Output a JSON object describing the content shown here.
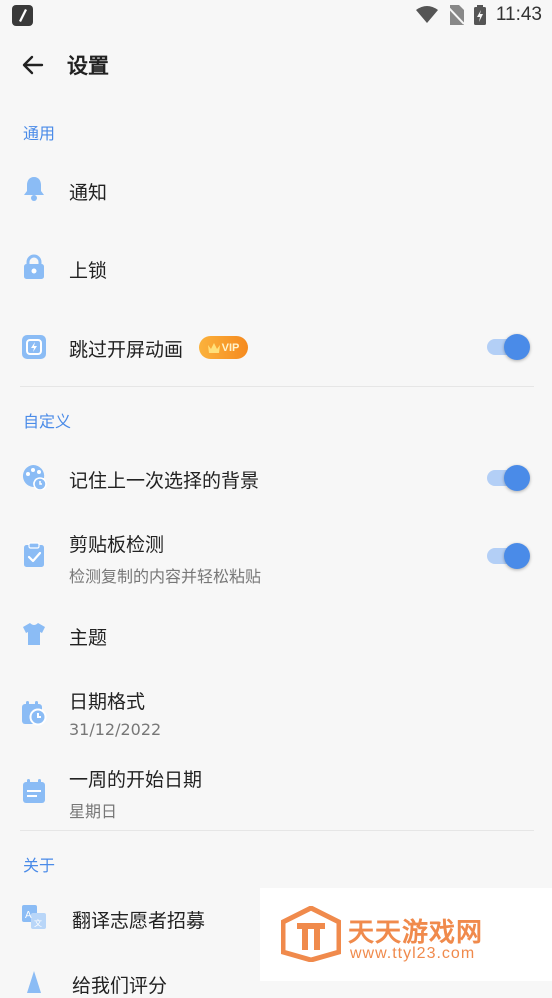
{
  "status_bar": {
    "time": "11:43"
  },
  "app_bar": {
    "title": "设置"
  },
  "sections": {
    "general": "通用",
    "custom": "自定义",
    "about": "关于"
  },
  "items": {
    "notification": {
      "label": "通知"
    },
    "lock": {
      "label": "上锁"
    },
    "skip_splash": {
      "label": "跳过开屏动画",
      "badge": "VIP",
      "toggle_on": true
    },
    "remember_bg": {
      "label": "记住上一次选择的背景",
      "toggle_on": true
    },
    "clipboard": {
      "label": "剪贴板检测",
      "subtitle": "检测复制的内容并轻松粘贴",
      "toggle_on": true
    },
    "theme": {
      "label": "主题"
    },
    "date_format": {
      "label": "日期格式",
      "subtitle": "31/12/2022"
    },
    "week_start": {
      "label": "一周的开始日期",
      "subtitle": "星期日"
    },
    "translate": {
      "label": "翻译志愿者招募"
    },
    "rate": {
      "label": "给我们评分"
    }
  },
  "watermark": {
    "name": "天天游戏网",
    "url": "www.ttyl23.com"
  },
  "colors": {
    "accent": "#4a8be8",
    "icon": "#8bbcf5",
    "vip": "#f59a28"
  }
}
